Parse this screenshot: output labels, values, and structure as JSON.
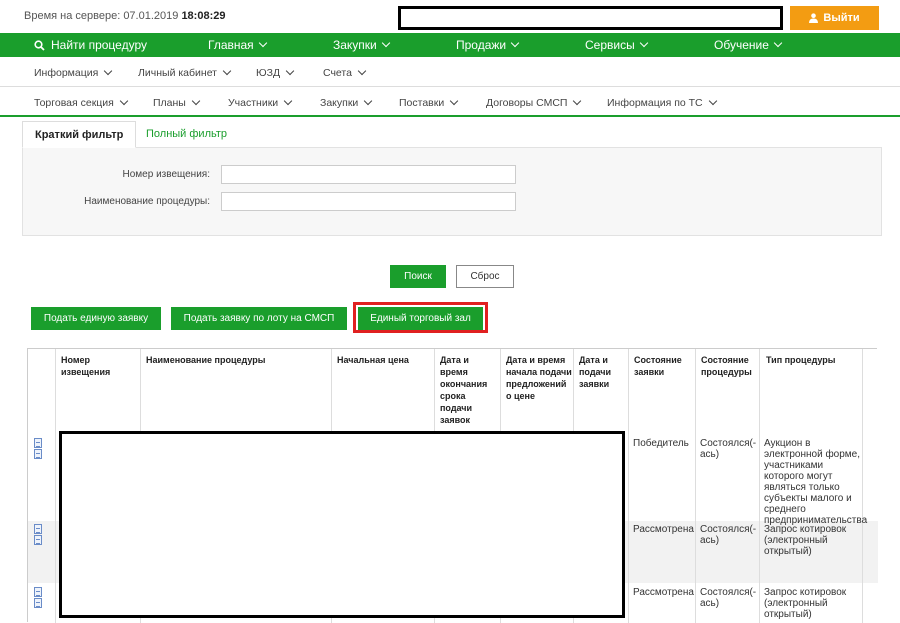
{
  "header": {
    "server_time_label": "Время на сервере: 07.01.2019",
    "server_time_value": "18:08:29",
    "exit_label": "Выйти"
  },
  "main_nav": {
    "find_label": "Найти процедуру",
    "items": [
      "Главная",
      "Закупки",
      "Продажи",
      "Сервисы",
      "Обучение"
    ]
  },
  "sub_nav_1": [
    "Информация",
    "Личный кабинет",
    "ЮЗД",
    "Счета"
  ],
  "sub_nav_2": [
    "Торговая секция",
    "Планы",
    "Участники",
    "Закупки",
    "Поставки",
    "Договоры СМСП",
    "Информация по ТС"
  ],
  "filter": {
    "tab_short": "Краткий фильтр",
    "tab_full": "Полный фильтр",
    "number_label": "Номер извещения:",
    "name_label": "Наименование процедуры:",
    "number_value": "",
    "name_value": ""
  },
  "actions": {
    "search": "Поиск",
    "reset": "Сброс",
    "submit_single": "Подать единую заявку",
    "submit_lot": "Подать заявку по лоту на СМСП",
    "trading_hall": "Единый торговый зал"
  },
  "table": {
    "headers": [
      "Номер извещения",
      "Наименование процедуры",
      "Начальная цена",
      "Дата и время окончания срока подачи заявок",
      "Дата и время начала подачи предложений о цене",
      "Дата и подачи заявки",
      "Состояние заявки",
      "Состояние процедуры",
      "Тип процедуры"
    ],
    "rows": [
      {
        "status": "Победитель",
        "proc_status": "Состоялся(-ась)",
        "type": "Аукцион в электронной форме, участниками которого могут являться только субъекты малого и среднего предпринимательства"
      },
      {
        "status": "Рассмотрена",
        "proc_status": "Состоялся(-ась)",
        "type": "Запрос котировок (электронный открытый)"
      },
      {
        "status": "Рассмотрена",
        "proc_status": "Состоялся(-ась)",
        "type": "Запрос котировок (электронный открытый)"
      }
    ]
  },
  "colors": {
    "green": "#1a9e2c",
    "orange": "#f39c12",
    "highlight": "#e02020"
  }
}
